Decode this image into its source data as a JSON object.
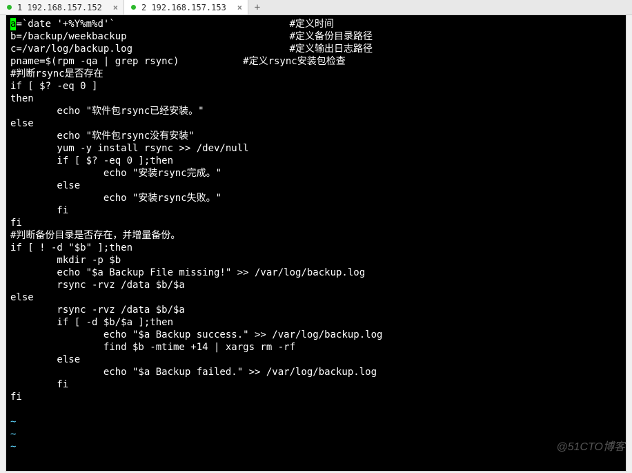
{
  "tabs": [
    {
      "label": "1 192.168.157.152",
      "active": false
    },
    {
      "label": "2 192.168.157.153",
      "active": true
    }
  ],
  "addtab": "+",
  "cursor_char": "a",
  "code_lines": [
    "=`date '+%Y%m%d'`                              #定义时间",
    "b=/backup/weekbackup                            #定义备份目录路径",
    "c=/var/log/backup.log                           #定义输出日志路径",
    "pname=$(rpm -qa | grep rsync)           #定义rsync安装包检查",
    "#判断rsync是否存在",
    "if [ $? -eq 0 ]",
    "then",
    "        echo \"软件包rsync已经安装。\"",
    "else",
    "        echo \"软件包rsync没有安装\"",
    "        yum -y install rsync >> /dev/null",
    "        if [ $? -eq 0 ];then",
    "                echo \"安装rsync完成。\"",
    "        else",
    "                echo \"安装rsync失败。\"",
    "        fi",
    "fi",
    "#判断备份目录是否存在，并增量备份。",
    "if [ ! -d \"$b\" ];then",
    "        mkdir -p $b",
    "        echo \"$a Backup File missing!\" >> /var/log/backup.log",
    "        rsync -rvz /data $b/$a",
    "else",
    "        rsync -rvz /data $b/$a",
    "        if [ -d $b/$a ];then",
    "                echo \"$a Backup success.\" >> /var/log/backup.log",
    "                find $b -mtime +14 | xargs rm -rf",
    "        else",
    "                echo \"$a Backup failed.\" >> /var/log/backup.log",
    "        fi",
    "fi",
    ""
  ],
  "tilde": "~",
  "tilde_count": 3,
  "watermark": "@51CTO博客"
}
